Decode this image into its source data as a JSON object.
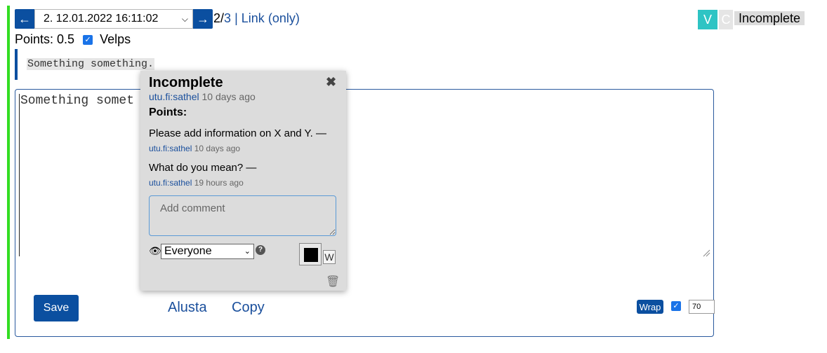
{
  "nav": {
    "prev_label": "←",
    "next_label": "→",
    "answer_select": "2. 12.01.2022 16:11:02",
    "counter_current": "2",
    "counter_total": "3",
    "separator": "|",
    "link_label": "Link",
    "only_label": "only",
    "paren_open": "(",
    "paren_close": ")",
    "slash": "/"
  },
  "badges": {
    "v": "V",
    "c": "C",
    "status": "Incomplete",
    "v_color": "#2ec4c4"
  },
  "points": {
    "label": "Points: 0.5",
    "velps_label": "Velps",
    "velps_checked": true
  },
  "quote": {
    "text": "Something something."
  },
  "editor": {
    "text": "Something somet"
  },
  "popup": {
    "title": "Incomplete",
    "author": "utu.fi:sathel",
    "author_time": "10 days ago",
    "points_label": "Points:",
    "comments": [
      {
        "text": "Please add information on X and Y. —",
        "user": "utu.fi:sathel",
        "time": "10 days ago"
      },
      {
        "text": "What do you mean? —",
        "user": "utu.fi:sathel",
        "time": "19 hours ago"
      }
    ],
    "comment_placeholder": "Add comment",
    "visibility": "Everyone",
    "color_swatch": "#000000",
    "w_label": "W"
  },
  "footer": {
    "save_label": "Save",
    "alusta_label": "Alusta",
    "copy_label": "Copy",
    "wrap_label": "Wrap",
    "wrap_checked": true,
    "wrap_value": "70"
  },
  "colors": {
    "accent": "#0b4fa0",
    "link": "#1a4f9c",
    "border_green": "#33dd22"
  }
}
